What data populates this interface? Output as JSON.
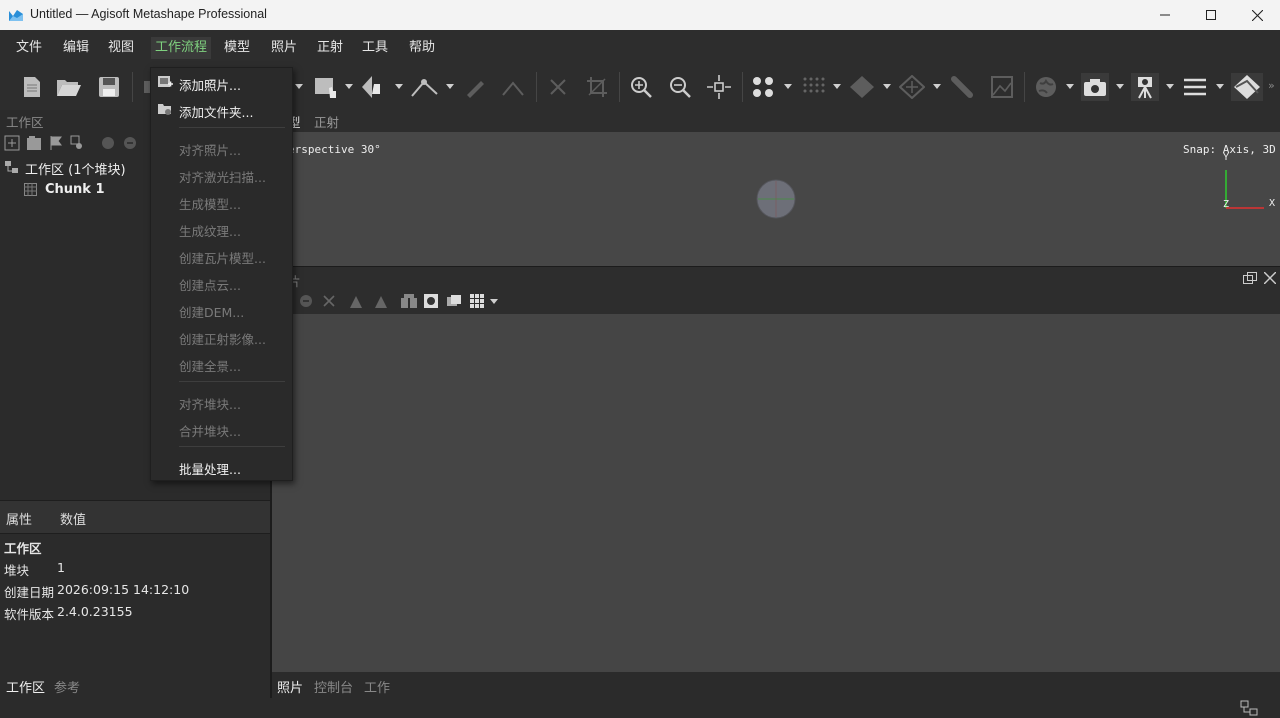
{
  "window": {
    "title": "Untitled — Agisoft Metashape Professional"
  },
  "menubar": [
    "文件",
    "编辑",
    "视图",
    "工作流程",
    "模型",
    "照片",
    "正射",
    "工具",
    "帮助"
  ],
  "workflow_menu": {
    "items": [
      {
        "label": "添加照片...",
        "enabled": true
      },
      {
        "label": "添加文件夹...",
        "enabled": true
      },
      {
        "label": "对齐照片...",
        "enabled": false
      },
      {
        "label": "对齐激光扫描...",
        "enabled": false
      },
      {
        "label": "生成模型...",
        "enabled": false
      },
      {
        "label": "生成纹理...",
        "enabled": false
      },
      {
        "label": "创建瓦片模型...",
        "enabled": false
      },
      {
        "label": "创建点云...",
        "enabled": false
      },
      {
        "label": "创建DEM...",
        "enabled": false
      },
      {
        "label": "创建正射影像...",
        "enabled": false
      },
      {
        "label": "创建全景...",
        "enabled": false
      },
      {
        "label": "对齐堆块...",
        "enabled": false
      },
      {
        "label": "合并堆块...",
        "enabled": false
      },
      {
        "label": "批量处理...",
        "enabled": true
      }
    ]
  },
  "workspace": {
    "title": "工作区",
    "root": "工作区 (1个堆块)",
    "chunk": "Chunk 1"
  },
  "view_tabs": [
    "型",
    "正射"
  ],
  "viewport": {
    "perspective": "erspective 30°",
    "snap": "Snap: Axis, 3D",
    "axis_y": "Y",
    "axis_z": "Z",
    "axis_x": "X"
  },
  "photos_title": "片",
  "properties": {
    "col_name": "属性",
    "col_value": "数值",
    "section": "工作区",
    "rows": [
      {
        "name": "堆块",
        "value": "1"
      },
      {
        "name": "创建日期",
        "value": "2026:09:15 14:12:10"
      },
      {
        "name": "软件版本",
        "value": "2.4.0.23155"
      }
    ]
  },
  "left_tabs": [
    "工作区",
    "参考"
  ],
  "right_tabs": [
    "照片",
    "控制台",
    "工作"
  ]
}
